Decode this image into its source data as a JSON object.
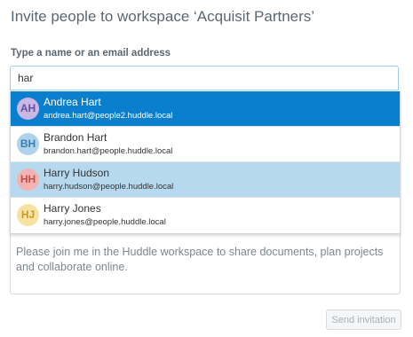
{
  "dialog": {
    "title": "Invite people to workspace ‘Acquisit Partners’",
    "field_label": "Type a name or an email address"
  },
  "search": {
    "value": "har",
    "placeholder": ""
  },
  "suggestions": [
    {
      "initials": "AH",
      "name": "Andrea Hart",
      "email": "andrea.hart@people2.huddle.local",
      "avatar_bg": "#c9b8e6",
      "avatar_fg": "#6a4fa1",
      "state": "selected"
    },
    {
      "initials": "BH",
      "name": "Brandon Hart",
      "email": "brandon.hart@people.huddle.local",
      "avatar_bg": "#aed3ea",
      "avatar_fg": "#3a7fb0",
      "state": "normal"
    },
    {
      "initials": "HH",
      "name": "Harry Hudson",
      "email": "harry.hudson@people.huddle.local",
      "avatar_bg": "#f2b3b3",
      "avatar_fg": "#c0504d",
      "state": "hover"
    },
    {
      "initials": "HJ",
      "name": "Harry Jones",
      "email": "harry.jones@people.huddle.local",
      "avatar_bg": "#f7e3a1",
      "avatar_fg": "#c99a2e",
      "state": "normal"
    }
  ],
  "message": {
    "text": "Please join me in the Huddle workspace to share documents, plan projects and collaborate online."
  },
  "actions": {
    "send_label": "Send invitation"
  },
  "colors": {
    "selected_bg": "#0a7fcd",
    "hover_bg": "#b6d9ef"
  }
}
